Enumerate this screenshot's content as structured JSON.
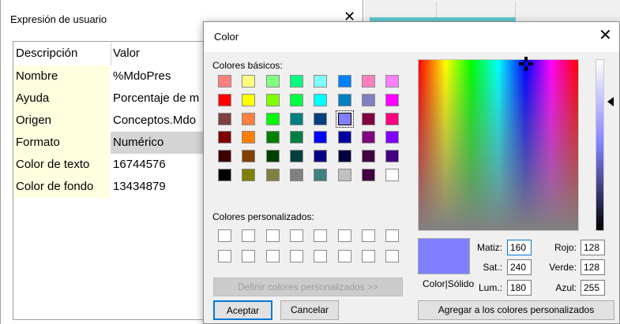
{
  "expression_dialog": {
    "title": "Expresión de usuario",
    "close": "✕",
    "header": {
      "name": "Descripción",
      "value": "Valor"
    },
    "rows": [
      {
        "name": "Nombre",
        "value": "%MdoPres"
      },
      {
        "name": "Ayuda",
        "value": "Porcentaje de m"
      },
      {
        "name": "Origen",
        "value": "Conceptos.Mdo"
      },
      {
        "name": "Formato",
        "value": "Numérico"
      },
      {
        "name": "Color de texto",
        "value": "16744576"
      },
      {
        "name": "Color de fondo",
        "value": "13434879"
      }
    ]
  },
  "color_dialog": {
    "title": "Color",
    "close": "✕",
    "basic_label": "Colores básicos:",
    "custom_label": "Colores personalizados:",
    "basic_colors": [
      [
        "#ff8080",
        "#ffff80",
        "#80ff80",
        "#00ff80",
        "#80ffff",
        "#0080ff",
        "#ff80c0",
        "#ff80ff"
      ],
      [
        "#ff0000",
        "#ffff00",
        "#80ff00",
        "#00ff40",
        "#00ffff",
        "#0080c0",
        "#8080c0",
        "#ff00ff"
      ],
      [
        "#804040",
        "#ff8040",
        "#00ff00",
        "#008080",
        "#004080",
        "#8080ff",
        "#800040",
        "#ff0080"
      ],
      [
        "#800000",
        "#ff8000",
        "#008000",
        "#008040",
        "#0000ff",
        "#0000a0",
        "#800080",
        "#8000ff"
      ],
      [
        "#400000",
        "#804000",
        "#004000",
        "#004040",
        "#000080",
        "#000040",
        "#400040",
        "#400080"
      ],
      [
        "#000000",
        "#808000",
        "#808040",
        "#808080",
        "#408080",
        "#c0c0c0",
        "#400040",
        "#ffffff"
      ]
    ],
    "selected_basic": "#8080ff",
    "define_button": "Definir colores personalizados >>",
    "accept_button": "Aceptar",
    "cancel_button": "Cancelar",
    "add_button": "Agregar a los colores personalizados",
    "preview_label": "Color|Sólido",
    "preview_color": "#8080ff",
    "fields": {
      "hue": {
        "label": "Matiz:",
        "value": "160"
      },
      "sat": {
        "label": "Sat.:",
        "value": "240"
      },
      "lum": {
        "label": "Lum.:",
        "value": "180"
      },
      "red": {
        "label": "Rojo:",
        "value": "128"
      },
      "green": {
        "label": "Verde:",
        "value": "128"
      },
      "blue": {
        "label": "Azul:",
        "value": "255"
      }
    }
  }
}
